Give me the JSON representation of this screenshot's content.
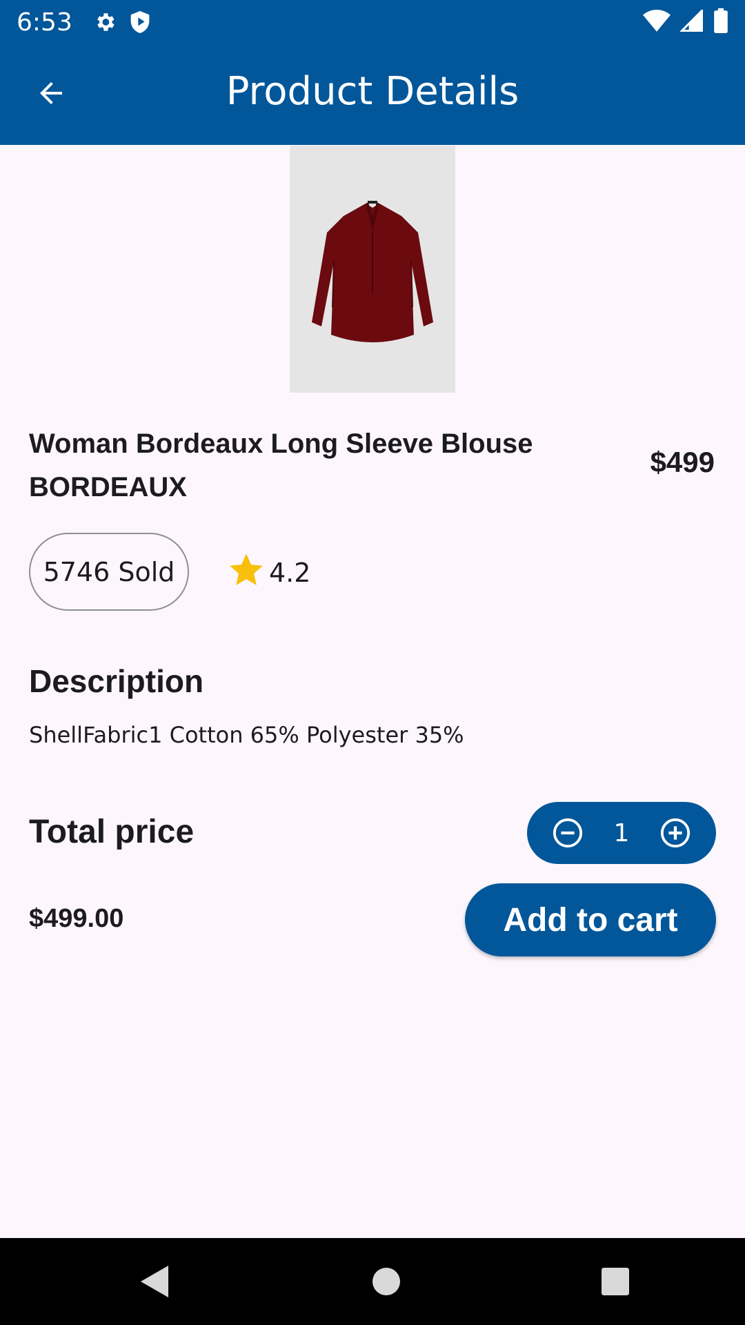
{
  "status_bar": {
    "time": "6:53",
    "icons": [
      "gear-icon",
      "shield-icon",
      "wifi-icon",
      "signal-icon",
      "battery-icon"
    ]
  },
  "app_bar": {
    "title": "Product Details",
    "back_icon": "arrow-back-icon",
    "background_color": "#02579a"
  },
  "product": {
    "image_description_icon": "blouse-image",
    "name": "Woman Bordeaux Long Sleeve Blouse BORDEAUX",
    "price": "$499",
    "sold_label": "5746 Sold",
    "rating": "4.2",
    "rating_icon": "star-icon"
  },
  "description": {
    "heading": "Description",
    "text": "ShellFabric1 Cotton 65% Polyester 35%"
  },
  "total": {
    "heading": "Total price",
    "value": "$499.00",
    "quantity": "1",
    "add_to_cart_label": "Add to cart"
  },
  "nav_bar": {
    "icons": [
      "back-triangle-icon",
      "home-circle-icon",
      "recents-square-icon"
    ]
  },
  "colors": {
    "primary": "#02579a",
    "background": "#fdf7fd",
    "star": "#f8c00b",
    "product_color": "#6b0a0f"
  }
}
